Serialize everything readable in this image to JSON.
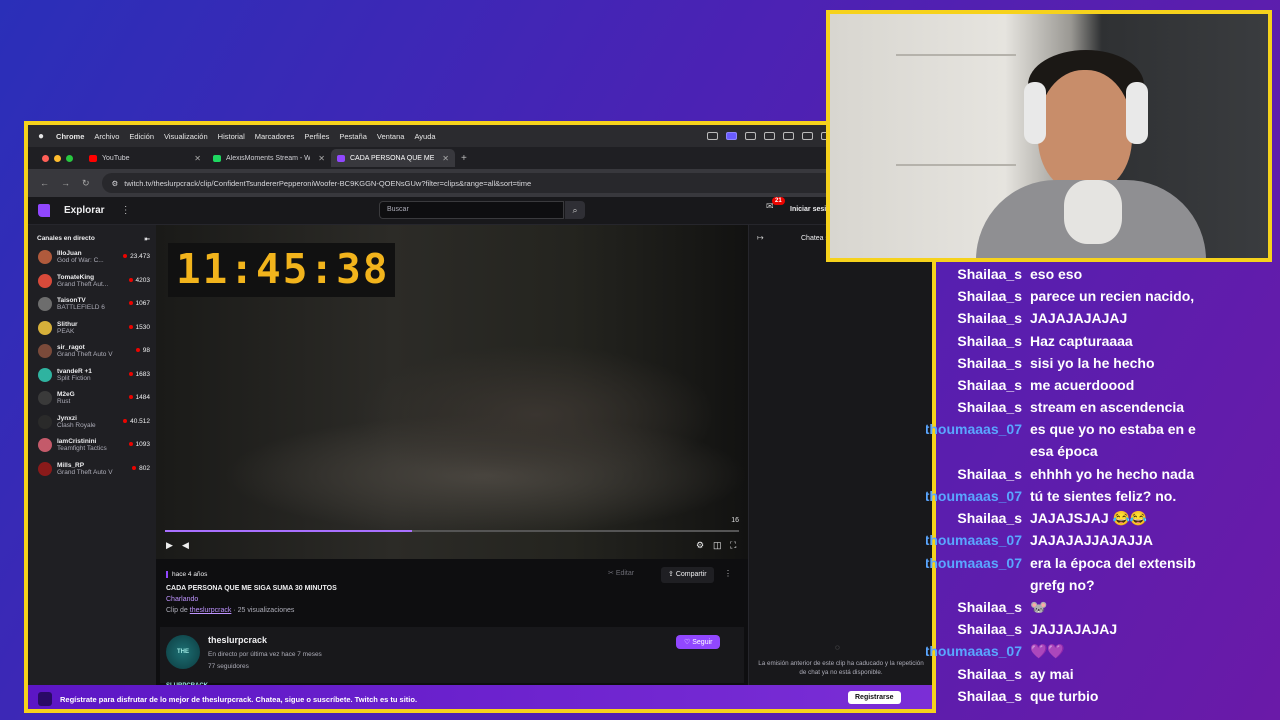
{
  "menubar": {
    "items": [
      "Chrome",
      "Archivo",
      "Edición",
      "Visualización",
      "Historial",
      "Marcadores",
      "Perfiles",
      "Pestaña",
      "Ventana",
      "Ayuda"
    ]
  },
  "tabs": [
    {
      "title": "YouTube",
      "favicon_color": "#ff0000"
    },
    {
      "title": "AlexisMoments Stream - Wan",
      "favicon_color": "#1ed760"
    },
    {
      "title": "CADA PERSONA QUE ME SI",
      "favicon_color": "#9147ff"
    }
  ],
  "url": "twitch.tv/theslurpcrack/clip/ConfidentTsundererPepperoniWoofer-BC9KGGN-QOENsGUw?filter=clips&range=all&sort=time",
  "twitch": {
    "explore": "Explorar",
    "search_placeholder": "Buscar",
    "notif_count": "21",
    "login": "Iniciar sesión",
    "sidebar_title": "Canales en directo",
    "channels": [
      {
        "name": "IlloJuan",
        "game": "God of War: C...",
        "viewers": "23.473",
        "color": "#b05a3c"
      },
      {
        "name": "TomateKing",
        "game": "Grand Theft Aut...",
        "viewers": "4203",
        "color": "#d84a3a"
      },
      {
        "name": "TaisonTV",
        "game": "BATTLEFIELD 6",
        "viewers": "1067",
        "color": "#6d6d6d"
      },
      {
        "name": "Slithur",
        "game": "PEAK",
        "viewers": "1530",
        "color": "#d6b03a"
      },
      {
        "name": "sir_ragot",
        "game": "Grand Theft Auto V",
        "viewers": "98",
        "color": "#7a4a3a"
      },
      {
        "name": "tvandeR +1",
        "game": "Split Fiction",
        "viewers": "1683",
        "color": "#2fb3a0"
      },
      {
        "name": "M2eG",
        "game": "Rust",
        "viewers": "1484",
        "color": "#3a3a3a"
      },
      {
        "name": "Jynxzi",
        "game": "Clash Royale",
        "viewers": "40.512",
        "color": "#2a2a2a"
      },
      {
        "name": "IamCristinini",
        "game": "Teamfight Tactics",
        "viewers": "1093",
        "color": "#c45a6a"
      },
      {
        "name": "Mills_RP",
        "game": "Grand Theft Auto V",
        "viewers": "802",
        "color": "#8a1a1a"
      }
    ],
    "clock": "11:45:38",
    "video_time": "16",
    "progress": 0.43,
    "clip": {
      "ago": "hace 4 años",
      "title": "CADA PERSONA QUE ME SIGA SUMA 30 MINUTOS",
      "category": "Charlando",
      "clip_by_prefix": "Clip de",
      "clip_by": "theslurpcrack",
      "views": "· 25 visualizaciones",
      "edit": "Editar",
      "share": "Compartir"
    },
    "channel": {
      "name": "theslurpcrack",
      "last_live": "En directo por última vez hace 7 meses",
      "followers": "77 seguidores",
      "follow": "Seguir",
      "avatar_text": "THE SLURPCRACK"
    },
    "chat_header": "Chatea sobre este clip",
    "chat_expired": "La emisión anterior de este clip ha caducado y la repetición de chat ya no está disponible.",
    "banner": "Regístrate para disfrutar de lo mejor de theslurpcrack. Chatea, sigue o suscríbete. Twitch es tu sitio.",
    "register": "Registrarse"
  },
  "chat_overlay": [
    {
      "user": "Shailaa_s",
      "text": "eso eso",
      "kind": "sh"
    },
    {
      "user": "Shailaa_s",
      "text": "parece un recien nacido,",
      "kind": "sh"
    },
    {
      "user": "Shailaa_s",
      "text": "JAJAJAJAJAJ",
      "kind": "sh"
    },
    {
      "user": "Shailaa_s",
      "text": "Haz capturaaaa",
      "kind": "sh"
    },
    {
      "user": "Shailaa_s",
      "text": "sisi yo la he hecho",
      "kind": "sh"
    },
    {
      "user": "Shailaa_s",
      "text": "me acuerdoood",
      "kind": "sh"
    },
    {
      "user": "Shailaa_s",
      "text": "stream en ascendencia",
      "kind": "sh"
    },
    {
      "user": "thoumaaas_07",
      "text": "es que yo no estaba en e",
      "text2": "esa época",
      "kind": "th"
    },
    {
      "user": "Shailaa_s",
      "text": "ehhhh yo he hecho nada",
      "kind": "sh"
    },
    {
      "user": "thoumaaas_07",
      "text": "tú te sientes feliz? no.",
      "kind": "th"
    },
    {
      "user": "Shailaa_s",
      "text": "JAJAJSJAJ 😂😂",
      "kind": "sh"
    },
    {
      "user": "thoumaaas_07",
      "text": "JAJAJAJJAJAJJA",
      "kind": "th"
    },
    {
      "user": "thoumaaas_07",
      "text": "era la época del extensib",
      "text2": "grefg no?",
      "kind": "th"
    },
    {
      "user": "Shailaa_s",
      "text": "🐭",
      "kind": "sh"
    },
    {
      "user": "Shailaa_s",
      "text": "JAJJAJAJAJ",
      "kind": "sh"
    },
    {
      "user": "thoumaaas_07",
      "text": "💜💜",
      "kind": "th"
    },
    {
      "user": "Shailaa_s",
      "text": "ay mai",
      "kind": "sh"
    },
    {
      "user": "Shailaa_s",
      "text": "que turbio",
      "kind": "sh"
    }
  ]
}
